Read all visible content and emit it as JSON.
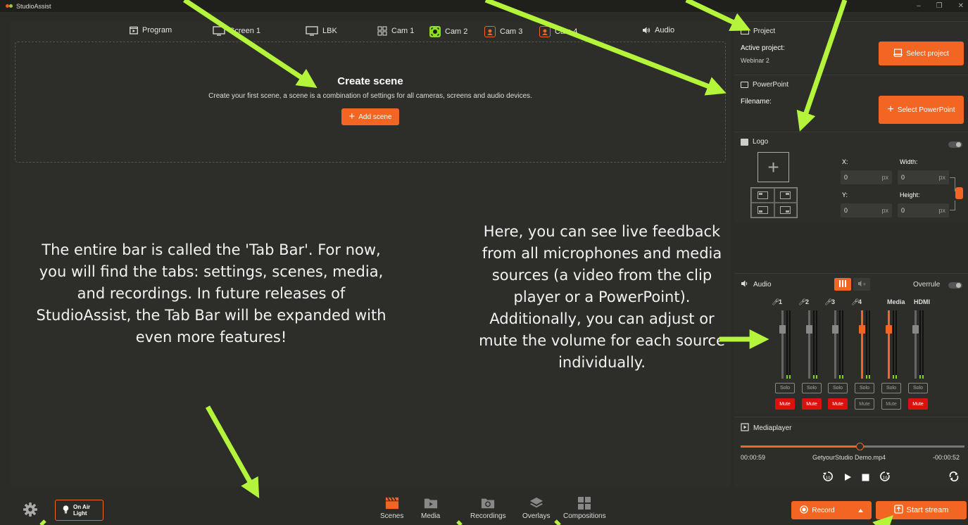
{
  "app": {
    "title": "StudioAssist",
    "window_controls": [
      "–",
      "❐",
      "✕"
    ]
  },
  "tabs": [
    {
      "label": "Program",
      "icon": "program-icon"
    },
    {
      "label": "Screen 1",
      "icon": "monitor-icon"
    },
    {
      "label": "LBK",
      "icon": "monitor-icon"
    },
    {
      "label": "Cam 1",
      "icon": "camera-group-icon"
    },
    {
      "label": "Cam 2",
      "icon": "camera-active-icon"
    },
    {
      "label": "Cam 3",
      "icon": "camera-icon"
    },
    {
      "label": "Cam 4",
      "icon": "camera-icon"
    },
    {
      "label": "Audio",
      "icon": "speaker-icon"
    }
  ],
  "scene": {
    "title": "Create scene",
    "description": "Create your first scene, a scene is a combination of settings for all cameras, screens and audio devices.",
    "add_label": "Add scene"
  },
  "annotations": {
    "left": "The entire bar is called the 'Tab Bar'. For now, you will find the tabs: settings, scenes, media, and recordings. In future releases of StudioAssist, the Tab Bar will be expanded with even more features!",
    "right": "Here, you can see live feedback from all microphones and media sources (a video from the clip player or a PowerPoint). Additionally, you can adjust or mute the volume for each source individually."
  },
  "project": {
    "header": "Project",
    "active_label": "Active project:",
    "active_value": "Webinar 2",
    "button": "Select project"
  },
  "powerpoint": {
    "header": "PowerPoint",
    "filename_label": "Filename:",
    "button": "Select PowerPoint"
  },
  "logo": {
    "header": "Logo",
    "enabled": false,
    "x_label": "X:",
    "x_value": "0",
    "y_label": "Y:",
    "y_value": "0",
    "width_label": "Width:",
    "width_value": "0",
    "height_label": "Height:",
    "height_value": "0",
    "unit": "px"
  },
  "audio": {
    "header": "Audio",
    "overrule_label": "Overrule",
    "solo_label": "Solo",
    "mute_label": "Mute",
    "channels": [
      {
        "label": "1",
        "level": 0.75,
        "active": false,
        "muted": true
      },
      {
        "label": "2",
        "level": 0.75,
        "active": false,
        "muted": true
      },
      {
        "label": "3",
        "level": 0.75,
        "active": false,
        "muted": true
      },
      {
        "label": "4",
        "level": 0.75,
        "active": true,
        "muted": false
      },
      {
        "label": "Media",
        "level": 0.75,
        "active": true,
        "muted": false
      },
      {
        "label": "HDMI",
        "level": 0.75,
        "active": false,
        "muted": true
      }
    ]
  },
  "mediaplayer": {
    "header": "Mediaplayer",
    "elapsed": "00:00:59",
    "filename": "GetyourStudio Demo.mp4",
    "remaining": "-00:00:52",
    "progress": 0.53
  },
  "bottom": {
    "onair_line1": "On Air",
    "onair_line2": "Light",
    "tabs": [
      {
        "label": "Scenes",
        "icon": "clapperboard-icon",
        "active": true
      },
      {
        "label": "Media",
        "icon": "media-icon"
      },
      {
        "label": "Recordings",
        "icon": "recordings-icon"
      },
      {
        "label": "Overlays",
        "icon": "layers-icon"
      },
      {
        "label": "Compositions",
        "icon": "grid-icon"
      }
    ],
    "record_label": "Record",
    "stream_label": "Start stream"
  },
  "colors": {
    "accent": "#f26522",
    "highlight": "#8ddc1f",
    "mute": "#d9120f",
    "arrow": "#b4f53b"
  }
}
